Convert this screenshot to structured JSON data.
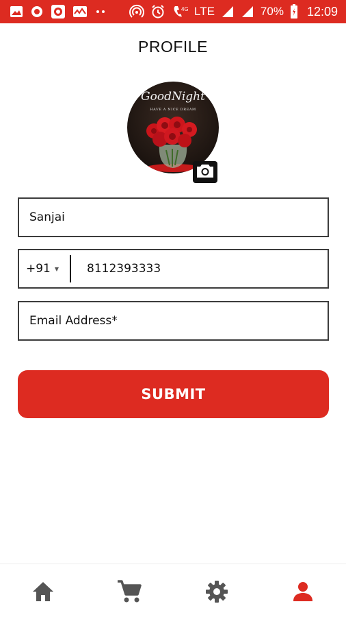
{
  "status_bar": {
    "battery": "70%",
    "time": "12:09",
    "network_type": "LTE",
    "signal_label": "4G",
    "icons": [
      "image-icon",
      "circle-icon",
      "record-icon",
      "activity-icon",
      "dots-icon",
      "hotspot-icon",
      "alarm-icon",
      "volte-icon",
      "signal-icon",
      "battery-icon"
    ]
  },
  "header": {
    "title": "PROFILE"
  },
  "avatar": {
    "script_text": "GoodNight",
    "caption_text": "HAVE A NICE DREAM"
  },
  "form": {
    "name_value": "Sanjai",
    "country_code": "+91",
    "phone_value": "8112393333",
    "email_placeholder": "Email Address*"
  },
  "submit": {
    "label": "SUBMIT"
  },
  "bottom_nav": {
    "items": [
      {
        "icon": "home-icon",
        "active": false
      },
      {
        "icon": "cart-icon",
        "active": false
      },
      {
        "icon": "settings-icon",
        "active": false
      },
      {
        "icon": "profile-icon",
        "active": true
      }
    ]
  },
  "colors": {
    "accent": "#dd2b21",
    "nav_inactive": "#555555",
    "text": "#111111"
  }
}
